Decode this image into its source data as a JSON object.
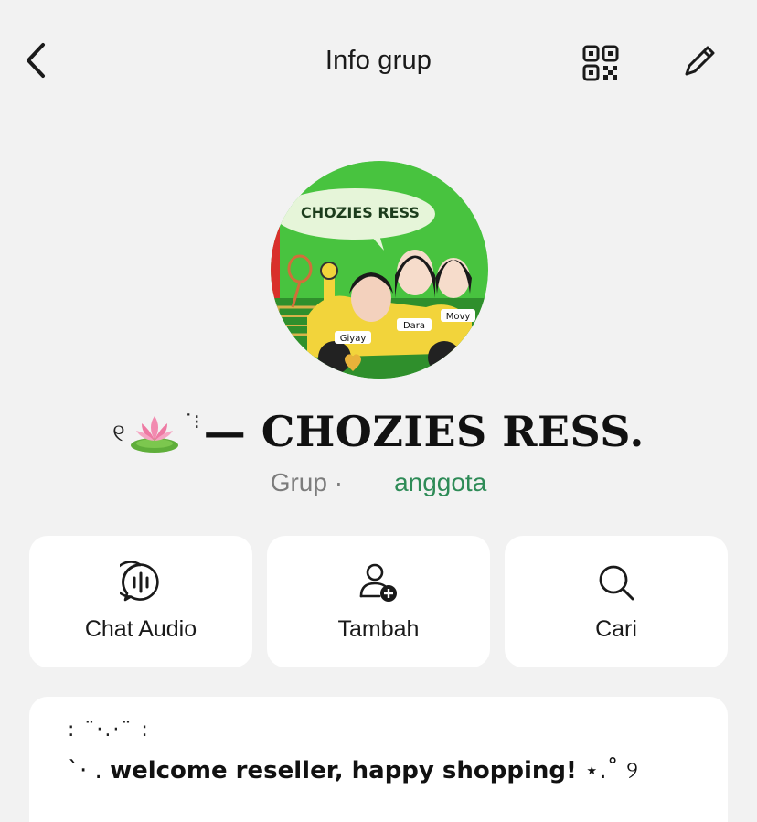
{
  "header": {
    "title": "Info grup",
    "back_icon": "chevron-left-icon",
    "qr_icon": "qr-code-icon",
    "edit_icon": "pencil-icon"
  },
  "group": {
    "avatar_caption": "CHOZIES RESS",
    "avatar_tags": [
      "Giyay",
      "Dara",
      "Movy"
    ],
    "name_prefix_left": "୧",
    "name_prefix_mid": "˙⁝",
    "name": "— CHOZIES RESS.",
    "type_label": "Grup ·",
    "member_label": "anggota"
  },
  "actions": [
    {
      "label": "Chat Audio",
      "icon": "audio-chat-icon"
    },
    {
      "label": "Tambah",
      "icon": "add-user-icon"
    },
    {
      "label": "Cari",
      "icon": "search-icon"
    }
  ],
  "description": {
    "line1": ": ¨·.·¨ :",
    "line2_prefix": "`· .",
    "line2_text": "welcome reseller, happy shopping!",
    "line2_suffix": "⋆.˚ ୨"
  },
  "colors": {
    "background": "#f2f2f2",
    "card": "#ffffff",
    "member_link": "#2e8b57",
    "avatar_green": "#3fbf3a"
  }
}
